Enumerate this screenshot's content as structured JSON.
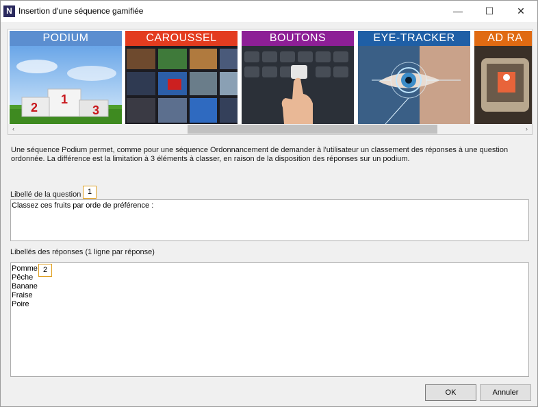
{
  "window": {
    "app_icon_letter": "N",
    "title": "Insertion d'une séquence gamifiée",
    "minimize_symbol": "—",
    "maximize_symbol": "☐",
    "close_symbol": "✕"
  },
  "gallery": {
    "tiles": [
      {
        "label": "PODIUM",
        "color": "#5b8ed0"
      },
      {
        "label": "CAROUSSEL",
        "color": "#e33c1f"
      },
      {
        "label": "BOUTONS",
        "color": "#8d1f96"
      },
      {
        "label": "EYE-TRACKER",
        "color": "#1f5fa6"
      },
      {
        "label": "AD RA",
        "color": "#e06a12"
      }
    ],
    "podium_places": [
      "2",
      "1",
      "3"
    ],
    "scroll_left": "‹",
    "scroll_right": "›"
  },
  "description": "Une séquence Podium permet, comme pour une séquence Ordonnancement de demander à l'utilisateur un classement des réponses à une question ordonnée. La différence est la limitation à 3 éléments à classer, en raison de la disposition des réponses sur un podium.",
  "question": {
    "label": "Libellé de la question",
    "marker": "1",
    "value": "Classez ces fruits par orde de préférence :"
  },
  "answers": {
    "label": "Libellés des réponses (1 ligne par réponse)",
    "marker": "2",
    "value": "Pomme\nPêche\nBanane\nFraise\nPoire"
  },
  "buttons": {
    "ok": "OK",
    "cancel": "Annuler"
  }
}
